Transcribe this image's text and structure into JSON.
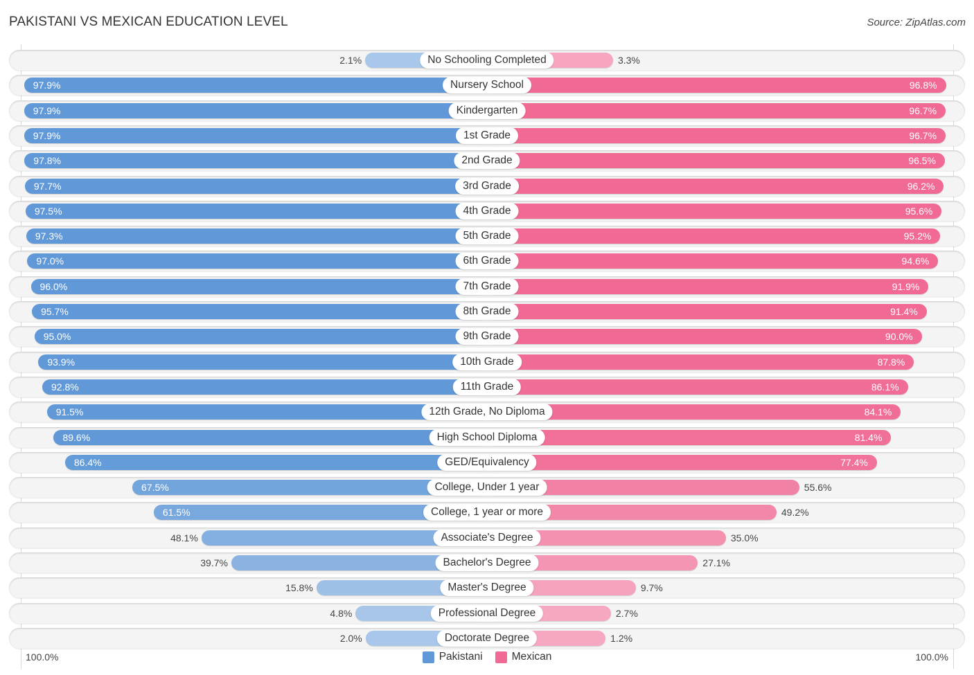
{
  "header": {
    "title": "PAKISTANI VS MEXICAN EDUCATION LEVEL",
    "source": "Source: ZipAtlas.com"
  },
  "axis": {
    "left_label": "100.0%",
    "right_label": "100.0%"
  },
  "legend": {
    "items": [
      {
        "name": "Pakistani",
        "color": "#6199d8"
      },
      {
        "name": "Mexican",
        "color": "#f06a93"
      }
    ]
  },
  "colors": {
    "pakistani_strong": "#6199d8",
    "pakistani_light": "#a9c7ea",
    "mexican_strong": "#f06a93",
    "mexican_light": "#f6a8c0"
  },
  "chart_data": {
    "type": "bar",
    "orientation": "horizontal-diverging",
    "title": "PAKISTANI VS MEXICAN EDUCATION LEVEL",
    "xlabel": "",
    "ylabel": "",
    "xlim": [
      0,
      100
    ],
    "legend_position": "bottom-center",
    "categories": [
      "No Schooling Completed",
      "Nursery School",
      "Kindergarten",
      "1st Grade",
      "2nd Grade",
      "3rd Grade",
      "4th Grade",
      "5th Grade",
      "6th Grade",
      "7th Grade",
      "8th Grade",
      "9th Grade",
      "10th Grade",
      "11th Grade",
      "12th Grade, No Diploma",
      "High School Diploma",
      "GED/Equivalency",
      "College, Under 1 year",
      "College, 1 year or more",
      "Associate's Degree",
      "Bachelor's Degree",
      "Master's Degree",
      "Professional Degree",
      "Doctorate Degree"
    ],
    "series": [
      {
        "name": "Pakistani",
        "side": "left",
        "values": [
          2.1,
          97.9,
          97.9,
          97.9,
          97.8,
          97.7,
          97.5,
          97.3,
          97.0,
          96.0,
          95.7,
          95.0,
          93.9,
          92.8,
          91.5,
          89.6,
          86.4,
          67.5,
          61.5,
          48.1,
          39.7,
          15.8,
          4.8,
          2.0
        ],
        "labels": [
          "2.1%",
          "97.9%",
          "97.9%",
          "97.9%",
          "97.8%",
          "97.7%",
          "97.5%",
          "97.3%",
          "97.0%",
          "96.0%",
          "95.7%",
          "95.0%",
          "93.9%",
          "92.8%",
          "91.5%",
          "89.6%",
          "86.4%",
          "67.5%",
          "61.5%",
          "48.1%",
          "39.7%",
          "15.8%",
          "4.8%",
          "2.0%"
        ]
      },
      {
        "name": "Mexican",
        "side": "right",
        "values": [
          3.3,
          96.8,
          96.7,
          96.7,
          96.5,
          96.2,
          95.6,
          95.2,
          94.6,
          91.9,
          91.4,
          90.0,
          87.8,
          86.1,
          84.1,
          81.4,
          77.4,
          55.6,
          49.2,
          35.0,
          27.1,
          9.7,
          2.7,
          1.2
        ],
        "labels": [
          "3.3%",
          "96.8%",
          "96.7%",
          "96.7%",
          "96.5%",
          "96.2%",
          "95.6%",
          "95.2%",
          "94.6%",
          "91.9%",
          "91.4%",
          "90.0%",
          "87.8%",
          "86.1%",
          "84.1%",
          "81.4%",
          "77.4%",
          "55.6%",
          "49.2%",
          "35.0%",
          "27.1%",
          "9.7%",
          "2.7%",
          "1.2%"
        ]
      }
    ]
  }
}
